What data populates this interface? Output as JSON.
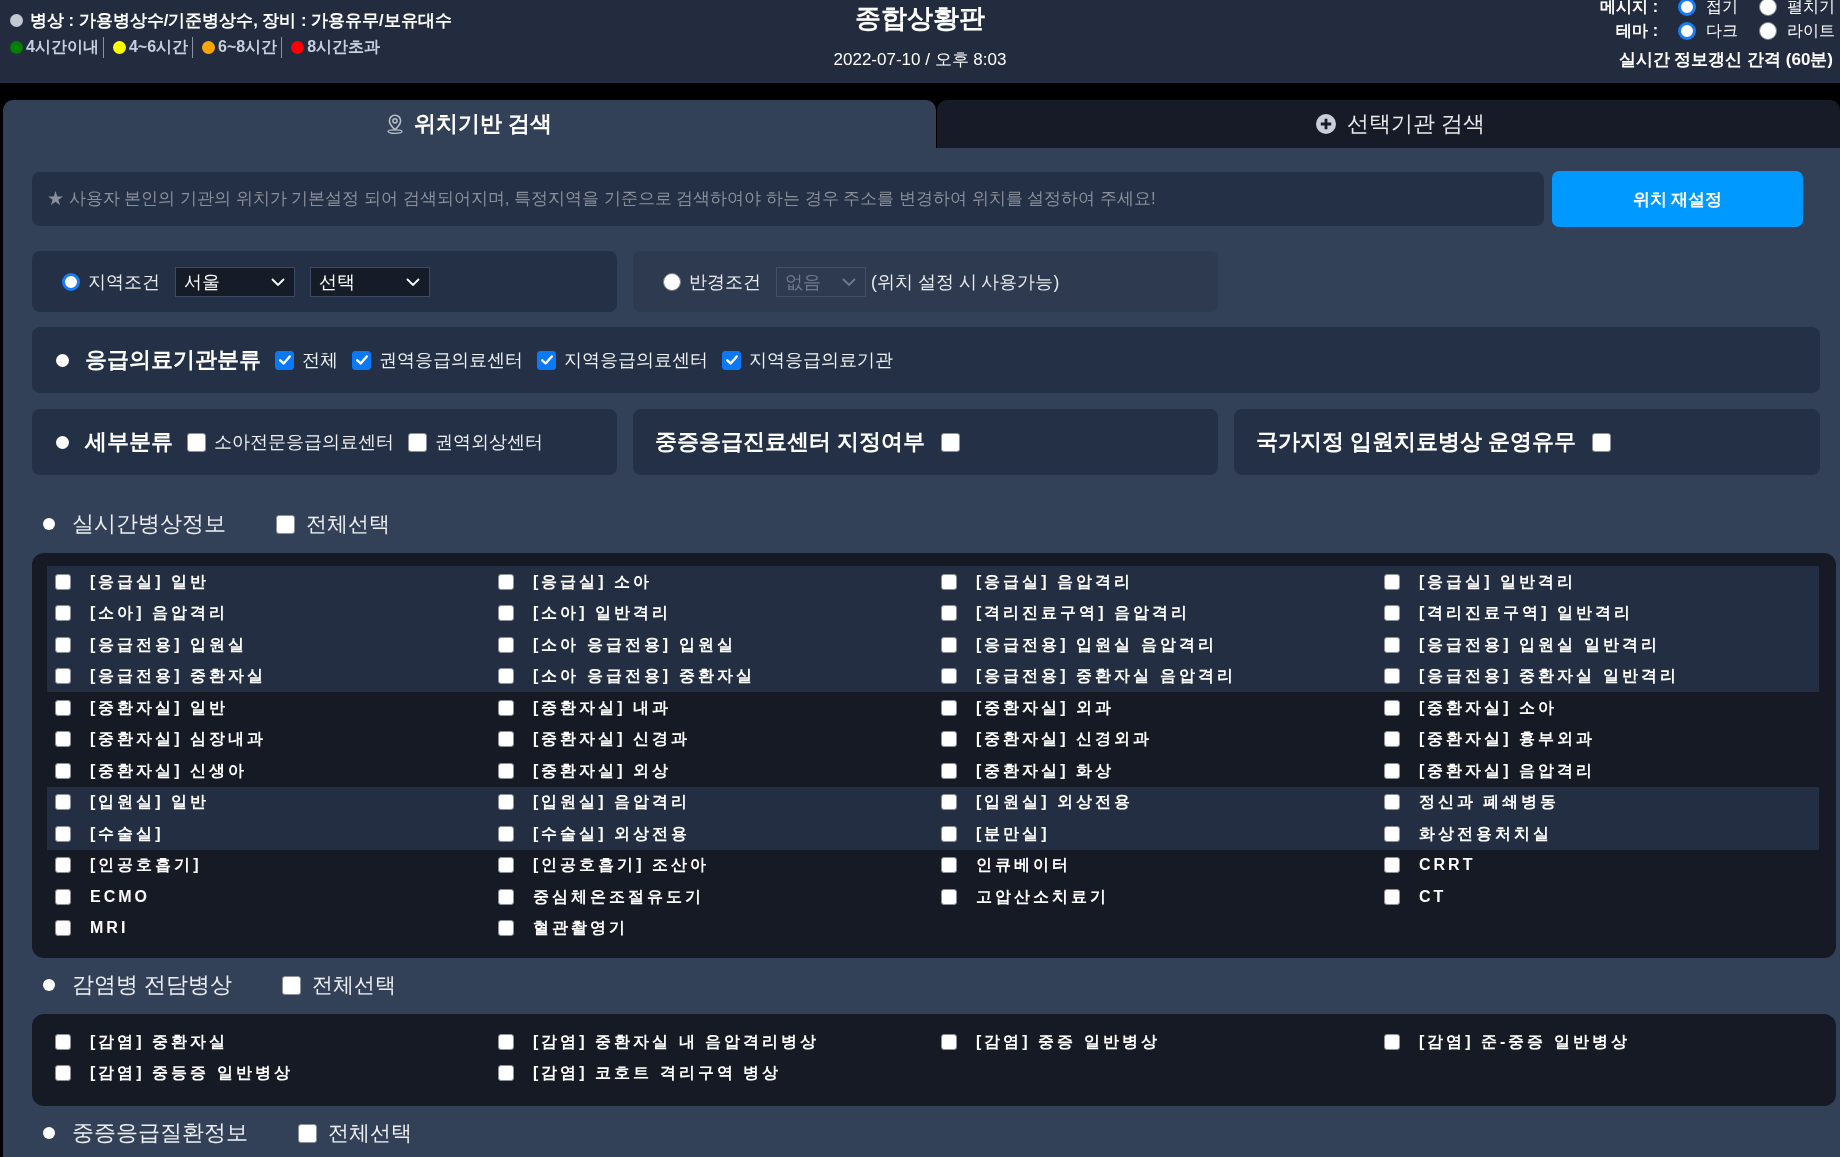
{
  "header": {
    "legend_note": "병상 : 가용병상수/기준병상수, 장비 : 가용유무/보유대수",
    "legend": [
      {
        "label": "4시간이내",
        "color": "#008000"
      },
      {
        "label": "4~6시간",
        "color": "#ffff00"
      },
      {
        "label": "6~8시간",
        "color": "#ffa500"
      },
      {
        "label": "8시간초과",
        "color": "#ff0000"
      }
    ],
    "title": "종합상황판",
    "datetime": "2022-07-10 / 오후 8:03",
    "settings": [
      {
        "label": "메시지 :",
        "options": [
          {
            "label": "접기",
            "selected": true
          },
          {
            "label": "펼치기",
            "selected": false
          }
        ]
      },
      {
        "label": "테마 :",
        "options": [
          {
            "label": "다크",
            "selected": true
          },
          {
            "label": "라이트",
            "selected": false
          }
        ]
      }
    ],
    "refresh_interval": "실시간 정보갱신 간격 (60분)"
  },
  "tabs": [
    {
      "label": "위치기반 검색",
      "selected": true
    },
    {
      "label": "선택기관 검색",
      "selected": false
    }
  ],
  "location": {
    "notice": {
      "placeholder": "★ 사용자 본인의 기관의 위치가 기본설정 되어 검색되어지며, 특정지역을 기준으로 검색하여야 하는 경우 주소를 변경하여 위치를 설정하여 주세요!"
    },
    "reset_button": "위치 재설정"
  },
  "conditions": [
    {
      "label": "지역조건",
      "selected": true,
      "selects": [
        {
          "value": "서울",
          "disabled": false
        },
        {
          "value": "선택",
          "disabled": false
        }
      ]
    },
    {
      "label": "반경조건",
      "selected": false,
      "selects": [
        {
          "value": "없음",
          "disabled": true
        }
      ],
      "note": "(위치 설정 시 사용가능)"
    }
  ],
  "classification": {
    "title": "응급의료기관분류",
    "options": [
      {
        "label": "전체",
        "checked": true
      },
      {
        "label": "권역응급의료센터",
        "checked": true
      },
      {
        "label": "지역응급의료센터",
        "checked": true
      },
      {
        "label": "지역응급의료기관",
        "checked": true
      }
    ]
  },
  "subclass": {
    "title": "세부분류",
    "options": [
      {
        "label": "소아전문응급의료센터",
        "checked": false
      },
      {
        "label": "권역외상센터",
        "checked": false
      }
    ]
  },
  "designations": [
    {
      "label": "중증응급진료센터 지정여부",
      "checked": false
    },
    {
      "label": "국가지정 입원치료병상 운영유무",
      "checked": false
    }
  ],
  "sections": [
    {
      "title": "실시간병상정보",
      "select_all": {
        "label": "전체선택",
        "checked": false
      },
      "groups": [
        {
          "shaded": true,
          "items": [
            {
              "label": "[응급실] 일반",
              "checked": false
            },
            {
              "label": "[응급실] 소아",
              "checked": false
            },
            {
              "label": "[응급실] 음압격리",
              "checked": false
            },
            {
              "label": "[응급실] 일반격리",
              "checked": false
            },
            {
              "label": "[소아] 음압격리",
              "checked": false
            },
            {
              "label": "[소아] 일반격리",
              "checked": false
            },
            {
              "label": "[격리진료구역] 음압격리",
              "checked": false
            },
            {
              "label": "[격리진료구역] 일반격리",
              "checked": false
            },
            {
              "label": "[응급전용] 입원실",
              "checked": false
            },
            {
              "label": "[소아 응급전용] 입원실",
              "checked": false
            },
            {
              "label": "[응급전용] 입원실 음압격리",
              "checked": false
            },
            {
              "label": "[응급전용] 입원실 일반격리",
              "checked": false
            },
            {
              "label": "[응급전용] 중환자실",
              "checked": false
            },
            {
              "label": "[소아 응급전용] 중환자실",
              "checked": false
            },
            {
              "label": "[응급전용] 중환자실 음압격리",
              "checked": false
            },
            {
              "label": "[응급전용] 중환자실 일반격리",
              "checked": false
            }
          ]
        },
        {
          "shaded": false,
          "items": [
            {
              "label": "[중환자실] 일반",
              "checked": false
            },
            {
              "label": "[중환자실] 내과",
              "checked": false
            },
            {
              "label": "[중환자실] 외과",
              "checked": false
            },
            {
              "label": "[중환자실] 소아",
              "checked": false
            },
            {
              "label": "[중환자실] 심장내과",
              "checked": false
            },
            {
              "label": "[중환자실] 신경과",
              "checked": false
            },
            {
              "label": "[중환자실] 신경외과",
              "checked": false
            },
            {
              "label": "[중환자실] 흉부외과",
              "checked": false
            },
            {
              "label": "[중환자실] 신생아",
              "checked": false
            },
            {
              "label": "[중환자실] 외상",
              "checked": false
            },
            {
              "label": "[중환자실] 화상",
              "checked": false
            },
            {
              "label": "[중환자실] 음압격리",
              "checked": false
            }
          ]
        },
        {
          "shaded": true,
          "items": [
            {
              "label": "[입원실] 일반",
              "checked": false
            },
            {
              "label": "[입원실] 음압격리",
              "checked": false
            },
            {
              "label": "[입원실] 외상전용",
              "checked": false
            },
            {
              "label": "정신과 폐쇄병동",
              "checked": false
            },
            {
              "label": "[수술실]",
              "checked": false
            },
            {
              "label": "[수술실] 외상전용",
              "checked": false
            },
            {
              "label": "[분만실]",
              "checked": false
            },
            {
              "label": "화상전용처치실",
              "checked": false
            }
          ]
        },
        {
          "shaded": false,
          "items": [
            {
              "label": "[인공호흡기]",
              "checked": false
            },
            {
              "label": "[인공호흡기] 조산아",
              "checked": false
            },
            {
              "label": "인큐베이터",
              "checked": false
            },
            {
              "label": "CRRT",
              "checked": false
            },
            {
              "label": "ECMO",
              "checked": false
            },
            {
              "label": "중심체온조절유도기",
              "checked": false
            },
            {
              "label": "고압산소치료기",
              "checked": false
            },
            {
              "label": "CT",
              "checked": false
            },
            {
              "label": "MRI",
              "checked": false
            },
            {
              "label": "혈관촬영기",
              "checked": false
            }
          ]
        }
      ]
    },
    {
      "title": "감염병 전담병상",
      "select_all": {
        "label": "전체선택",
        "checked": false
      },
      "groups": [
        {
          "shaded": false,
          "items": [
            {
              "label": "[감염] 중환자실",
              "checked": false
            },
            {
              "label": "[감염] 중환자실 내 음압격리병상",
              "checked": false
            },
            {
              "label": "[감염] 중증 일반병상",
              "checked": false
            },
            {
              "label": "[감염] 준-중증 일반병상",
              "checked": false
            },
            {
              "label": "[감염] 중등증 일반병상",
              "checked": false
            },
            {
              "label": "[감염] 코호트 격리구역 병상",
              "checked": false
            }
          ]
        }
      ]
    },
    {
      "title": "중증응급질환정보",
      "select_all": {
        "label": "전체선택",
        "checked": false
      }
    }
  ]
}
